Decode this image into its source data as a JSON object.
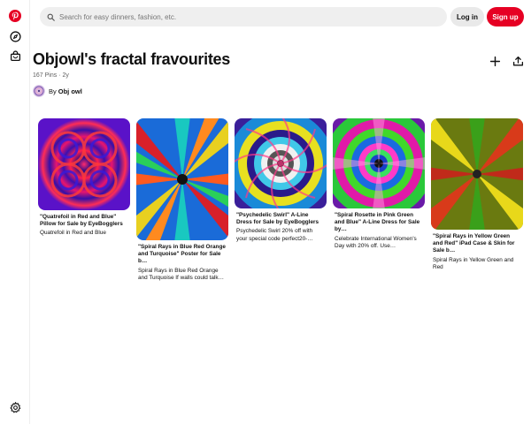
{
  "search": {
    "placeholder": "Search for easy dinners, fashion, etc."
  },
  "header_buttons": {
    "login": "Log in",
    "signup": "Sign up"
  },
  "brand_color": "#e60023",
  "board": {
    "title": "Objowl's fractal fravourites",
    "pin_count": "167 Pins",
    "separator": "·",
    "age": "2y",
    "owner_prefix": "By",
    "owner_name": "Obj owl"
  },
  "icons": {
    "rail": [
      "pinterest-logo-icon",
      "explore-compass-icon",
      "shop-bag-icon",
      "settings-gear-icon"
    ],
    "board_actions": [
      "plus-icon",
      "share-icon"
    ]
  },
  "pins": [
    {
      "title": "\"Quatrefoil in Red and Blue\" Pillow for Sale by EyeBogglers",
      "desc": "Quatrefoil in Red and Blue",
      "image": "red-blue-quatrefoil"
    },
    {
      "title": "\"Spiral Rays in Blue Red Orange and Turquoise\" Poster for Sale b…",
      "desc": "Spiral Rays in Blue Red Orange and Turquoise If walls could talk…",
      "image": "rainbow-spiral-rays"
    },
    {
      "title": "\"Psychedelic Swirl\" A-Line Dress for Sale by EyeBogglers",
      "desc": "Psychedelic Swirl 20% off with your special code perfect20-…",
      "image": "psychedelic-swirl"
    },
    {
      "title": "\"Spiral Rosette in Pink Green and Blue\" A-Line Dress for Sale by…",
      "desc": "Celebrate International Women's Day with 20% off. Use…",
      "image": "pink-green-rosette"
    },
    {
      "title": "\"Spiral Rays in Yellow Green and Red\" iPad Case & Skin for Sale b…",
      "desc": "Spiral Rays in Yellow Green and Red",
      "image": "yellow-green-spiral-rays"
    }
  ]
}
